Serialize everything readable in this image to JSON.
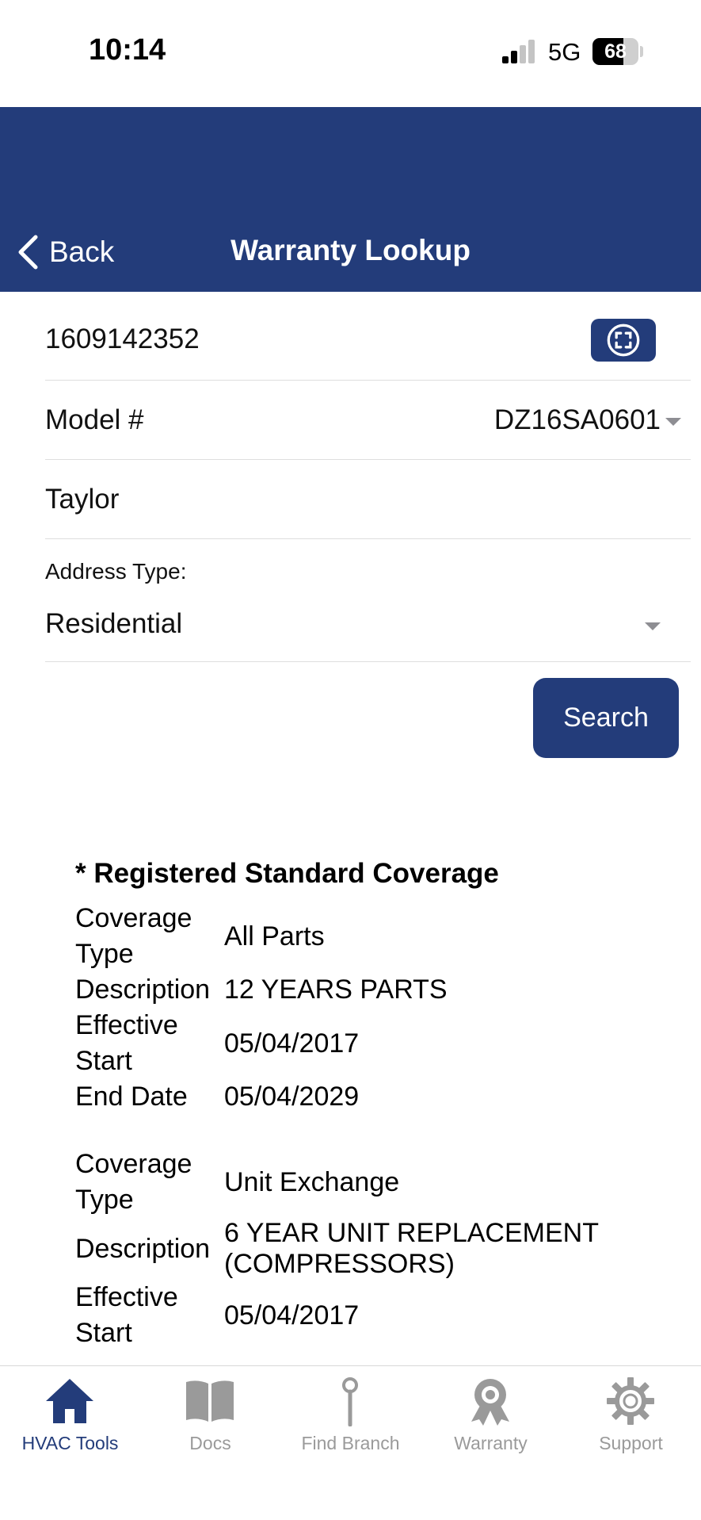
{
  "colors": {
    "brand": "#233c7a",
    "inactive_tab": "#9a9a9a",
    "battery_fill": "#000000"
  },
  "status_bar": {
    "time": "10:14",
    "network": "5G",
    "battery": "68",
    "battery_level_pct": 68,
    "signal_bars_active": 2,
    "signal_bars_total": 4
  },
  "nav": {
    "back_label": "Back",
    "title": "Warranty Lookup"
  },
  "form": {
    "serial_number": "1609142352",
    "scan_icon": "barcode-scan-icon",
    "model_label": "Model #",
    "model_value": "DZ16SA0601",
    "name_value": "Taylor",
    "address_type_label": "Address Type:",
    "address_type_value": "Residential",
    "search_label": "Search"
  },
  "coverage": {
    "heading": "* Registered Standard Coverage",
    "entries": [
      [
        {
          "label": "Coverage Type",
          "value": "All Parts"
        },
        {
          "label": "Description",
          "value": "12 YEARS PARTS"
        },
        {
          "label": "Effective Start",
          "value": "05/04/2017"
        },
        {
          "label": "End Date",
          "value": "05/04/2029"
        }
      ],
      [
        {
          "label": "Coverage Type",
          "value": "Unit Exchange"
        },
        {
          "label": "Description",
          "value": "6 YEAR UNIT REPLACEMENT (COMPRESSORS)"
        },
        {
          "label": "Effective Start",
          "value": "05/04/2017"
        }
      ]
    ]
  },
  "tabs": [
    {
      "label": "HVAC Tools",
      "icon": "home-icon",
      "active": true
    },
    {
      "label": "Docs",
      "icon": "book-icon",
      "active": false
    },
    {
      "label": "Find Branch",
      "icon": "map-pin-icon",
      "active": false
    },
    {
      "label": "Warranty",
      "icon": "award-ribbon-icon",
      "active": false
    },
    {
      "label": "Support",
      "icon": "gear-icon",
      "active": false
    }
  ]
}
